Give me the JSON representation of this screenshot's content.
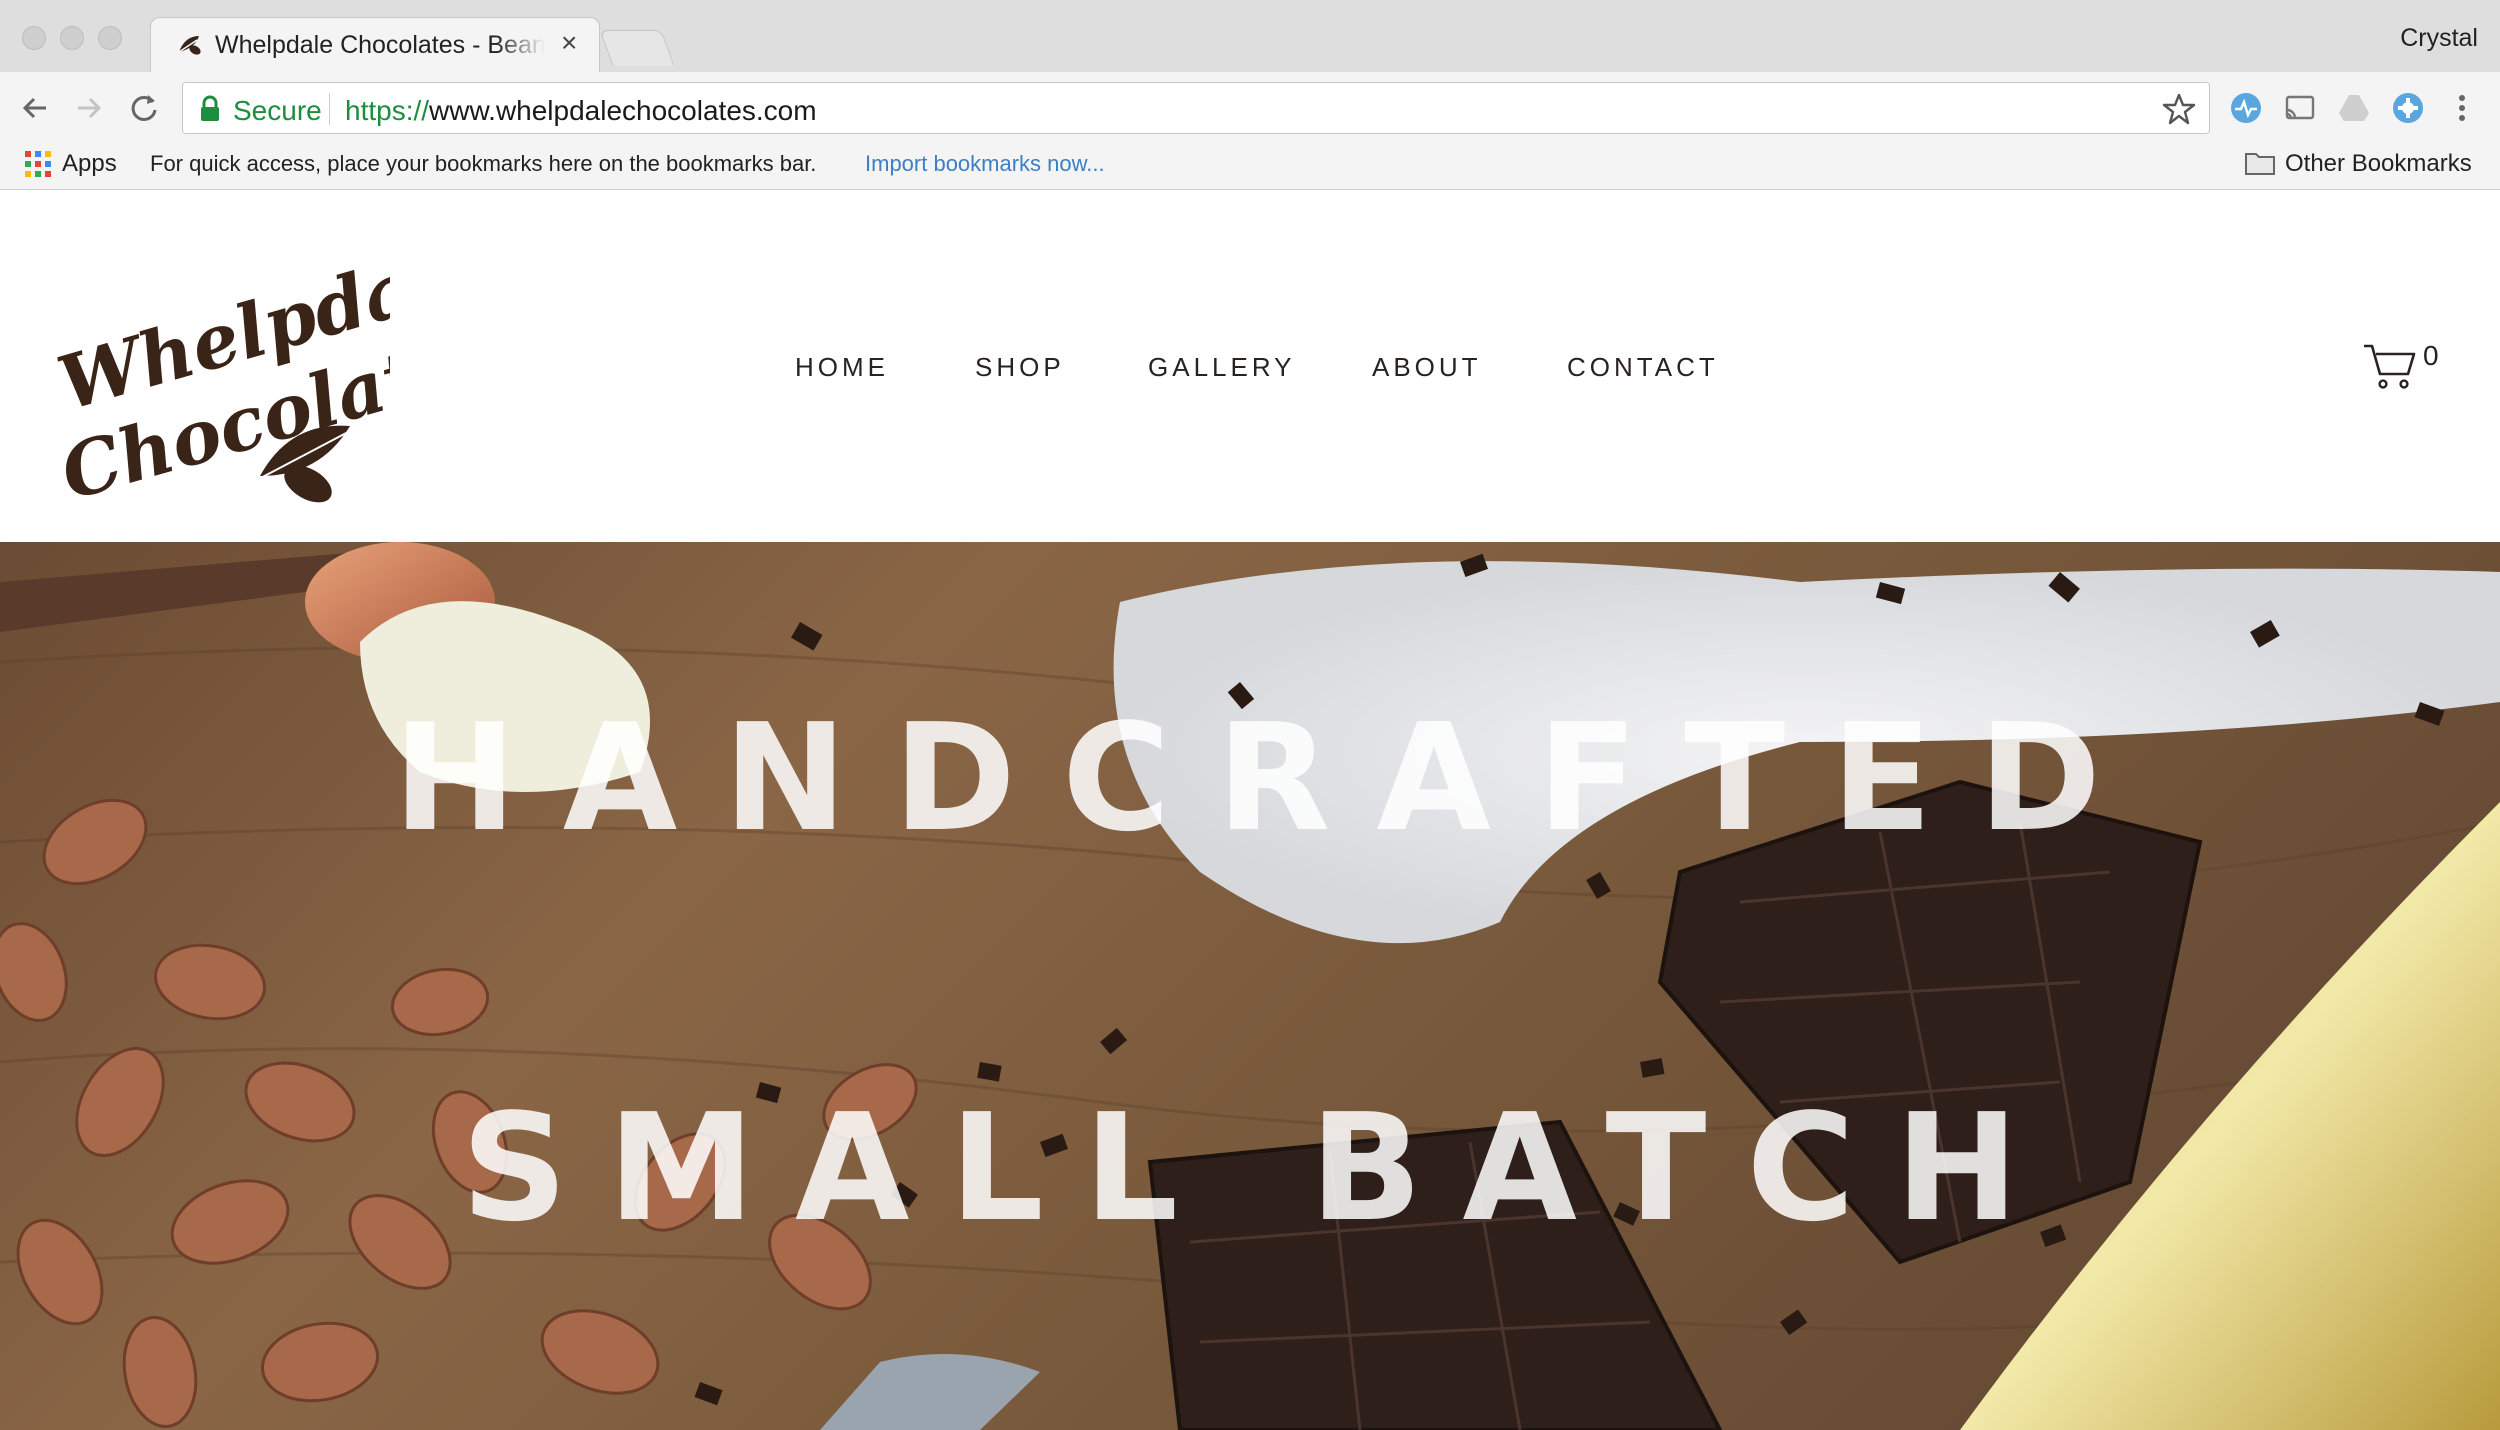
{
  "browser": {
    "tab_title": "Whelpdale Chocolates - Bean to Bar",
    "tab_close": "×",
    "profile_name": "Crystal",
    "secure_label": "Secure",
    "url_scheme": "https://",
    "url_rest": "www.whelpdalechocolates.com",
    "bookmarks": {
      "apps_label": "Apps",
      "hint": "For quick access, place your bookmarks here on the bookmarks bar.",
      "import_link": "Import bookmarks now...",
      "other_label": "Other Bookmarks"
    },
    "icons": [
      "back-arrow-icon",
      "forward-arrow-icon",
      "reload-icon",
      "lock-icon",
      "star-icon",
      "extension-icon",
      "cast-icon",
      "drive-icon",
      "extension-icon",
      "menu-dots-icon"
    ]
  },
  "site": {
    "logo": {
      "line1": "Whelpdale",
      "line2": "Chocolates",
      "color": "#3a2418"
    },
    "nav": [
      {
        "label": "HOME"
      },
      {
        "label": "SHOP"
      },
      {
        "label": "GALLERY"
      },
      {
        "label": "ABOUT"
      },
      {
        "label": "CONTACT"
      }
    ],
    "cart_count": "0",
    "hero": {
      "line1": "HANDCRAFTED",
      "line2": "SMALL BATCH"
    }
  }
}
